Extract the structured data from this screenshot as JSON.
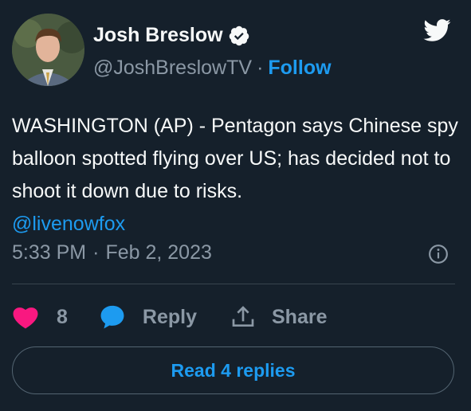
{
  "author": {
    "name": "Josh Breslow",
    "handle": "@JoshBreslowTV",
    "separator": "·",
    "follow_label": "Follow"
  },
  "tweet": {
    "text": "WASHINGTON (AP) - Pentagon says Chinese spy balloon spotted flying over US; has decided not to shoot it down due to risks.",
    "mention": "@livenowfox",
    "time": "5:33 PM",
    "separator": "·",
    "date": "Feb 2, 2023"
  },
  "actions": {
    "like_count": "8",
    "reply_label": "Reply",
    "share_label": "Share"
  },
  "replies_button": "Read 4 replies",
  "colors": {
    "background": "#15202b",
    "accent": "#1d9bf0",
    "like": "#f91880",
    "muted": "#8b98a5"
  },
  "icons": [
    "verified-badge-icon",
    "twitter-bird-icon",
    "info-icon",
    "heart-icon",
    "reply-bubble-icon",
    "share-icon"
  ]
}
